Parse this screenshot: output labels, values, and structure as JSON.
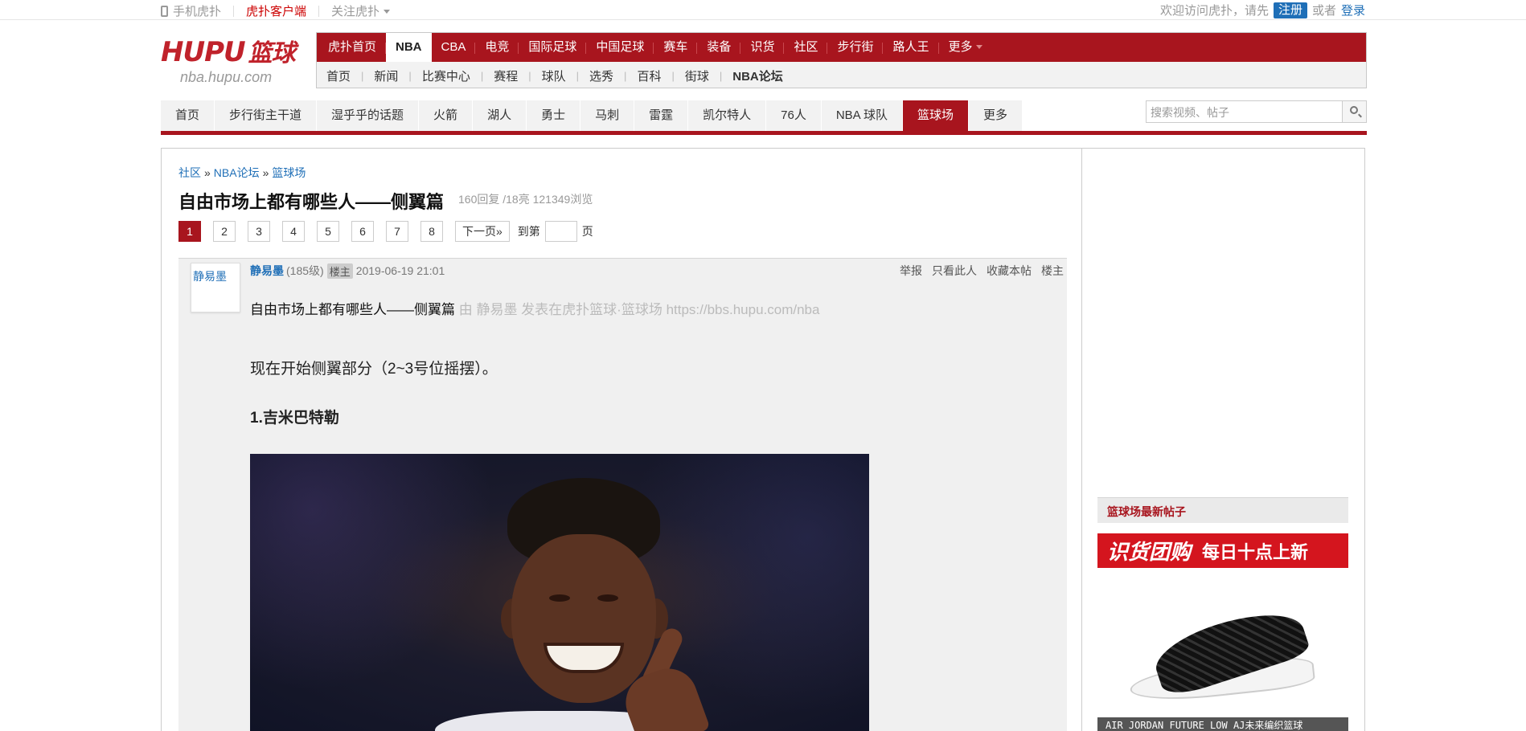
{
  "topbar": {
    "mobile": "手机虎扑",
    "client": "虎扑客户端",
    "follow": "关注虎扑",
    "welcome": "欢迎访问虎扑，请先",
    "register": "注册",
    "or": "或者",
    "login": "登录"
  },
  "logo": {
    "brand": "HUPU",
    "section": "篮球",
    "domain": "nba.hupu.com"
  },
  "mainnav": {
    "items": [
      "虎扑首页",
      "NBA",
      "CBA",
      "电竞",
      "国际足球",
      "中国足球",
      "赛车",
      "装备",
      "识货",
      "社区",
      "步行街",
      "路人王",
      "更多"
    ],
    "sub": [
      "首页",
      "新闻",
      "比赛中心",
      "赛程",
      "球队",
      "选秀",
      "百科",
      "街球",
      "NBA论坛"
    ]
  },
  "boardnav": {
    "items": [
      "首页",
      "步行街主干道",
      "湿乎乎的话题",
      "火箭",
      "湖人",
      "勇士",
      "马刺",
      "雷霆",
      "凯尔特人",
      "76人",
      "NBA 球队",
      "篮球场",
      "更多"
    ],
    "active_index": 11
  },
  "search": {
    "placeholder": "搜索视频、帖子"
  },
  "breadcrumb": {
    "c1": "社区",
    "c2": "NBA论坛",
    "c3": "篮球场",
    "sep": "»"
  },
  "thread": {
    "title": "自由市场上都有哪些人——侧翼篇",
    "stats": "160回复 /18亮  121349浏览"
  },
  "pager": {
    "pages": [
      "1",
      "2",
      "3",
      "4",
      "5",
      "6",
      "7",
      "8"
    ],
    "current": "1",
    "next": "下一页»",
    "goto_prefix": "到第",
    "goto_suffix": "页"
  },
  "post": {
    "author": "静易墨",
    "avatar_text": "静易墨",
    "level": "(185级)",
    "badge": "楼主",
    "time": "2019-06-19 21:01",
    "actions": [
      "举报",
      "只看此人",
      "收藏本帖",
      "楼主"
    ],
    "head_title": "自由市场上都有哪些人——侧翼篇",
    "head_from": "由 静易墨 发表在虎扑篮球·篮球场 https://bbs.hupu.com/nba",
    "para1": "现在开始侧翼部分（2~3号位摇摆）。",
    "para2": "1.吉米巴特勒"
  },
  "sidebar": {
    "heading": "篮球场最新帖子",
    "ad_brand": "识货团购",
    "ad_slogan": "每日十点上新",
    "ad_caption": "AIR JORDAN FUTURE LOW AJ未来编织篮球"
  }
}
